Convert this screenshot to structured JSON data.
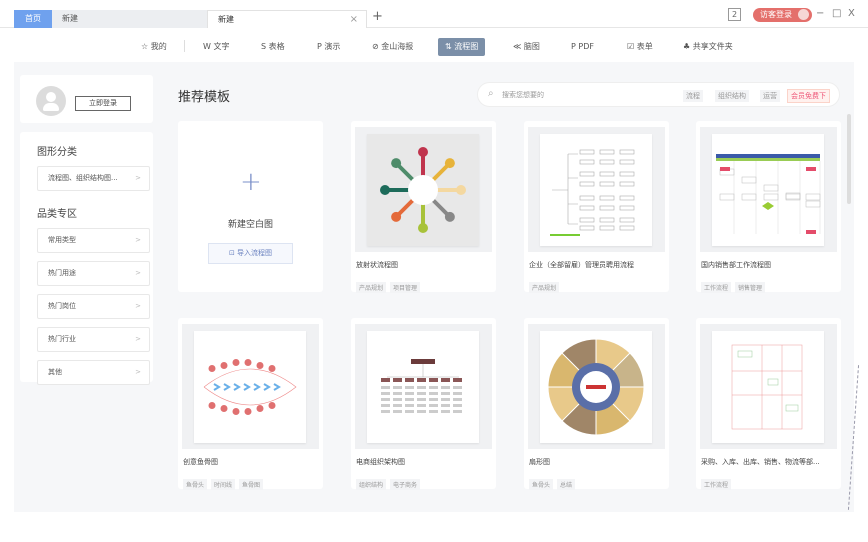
{
  "tabs": {
    "home": "首页",
    "tab1": "新建",
    "tab2": "新建",
    "close": "×",
    "add": "+"
  },
  "titlebar": {
    "badge": "2",
    "login": "访客登录",
    "minimize": "−",
    "maximize": "□",
    "close": "X"
  },
  "nav": [
    {
      "icon": "star-icon",
      "glyph": "☆",
      "label": "我的"
    },
    {
      "icon": "writer-icon",
      "glyph": "W",
      "label": "文字"
    },
    {
      "icon": "sheet-icon",
      "glyph": "S",
      "label": "表格"
    },
    {
      "icon": "slides-icon",
      "glyph": "P",
      "label": "演示"
    },
    {
      "icon": "poster-icon",
      "glyph": "⊘",
      "label": "金山海报"
    },
    {
      "icon": "flowchart-icon",
      "glyph": "⇅",
      "label": "流程图"
    },
    {
      "icon": "mindmap-icon",
      "glyph": "≪",
      "label": "脑图"
    },
    {
      "icon": "pdf-icon",
      "glyph": "P",
      "label": "PDF"
    },
    {
      "icon": "form-icon",
      "glyph": "☑",
      "label": "表单"
    },
    {
      "icon": "share-folder-icon",
      "glyph": "♣",
      "label": "共享文件夹"
    }
  ],
  "sidebar": {
    "login_button": "立即登录",
    "section1": "图形分类",
    "category": "流程图、组织结构图...",
    "section2": "品类专区",
    "items": [
      "常用类型",
      "热门用途",
      "热门岗位",
      "热门行业",
      "其他"
    ],
    "chevron": ">"
  },
  "main": {
    "title": "推荐模板",
    "search_placeholder": "搜索您想要的",
    "search_tags": [
      "流程",
      "组织结构",
      "运营"
    ],
    "search_promo": "会员免费下",
    "new_blank": "新建空白图",
    "import": "导入流程图",
    "new_plus": "+"
  },
  "templates": [
    {
      "name": "放射状流程图",
      "tags": [
        "产品规划",
        "项目管理"
      ]
    },
    {
      "name": "企业（全部留雇）管理员聘用流程",
      "tags": [
        "产品规划"
      ]
    },
    {
      "name": "国内销售部工作流程图",
      "tags": [
        "工作流程",
        "销售管理"
      ]
    },
    {
      "name": "创意鱼骨图",
      "tags": [
        "鱼骨头",
        "时间线",
        "鱼骨图"
      ]
    },
    {
      "name": "电商组织架构图",
      "tags": [
        "组织结构",
        "电子商务"
      ]
    },
    {
      "name": "扇形图",
      "tags": [
        "鱼骨头",
        "总结"
      ]
    },
    {
      "name": "采购、入库、出库、销售、物流等部...",
      "tags": [
        "工作流程"
      ]
    }
  ],
  "colors": {
    "accent": "#6fa1ee",
    "nav_active": "#7b8fa8",
    "login": "#e46f6b"
  }
}
